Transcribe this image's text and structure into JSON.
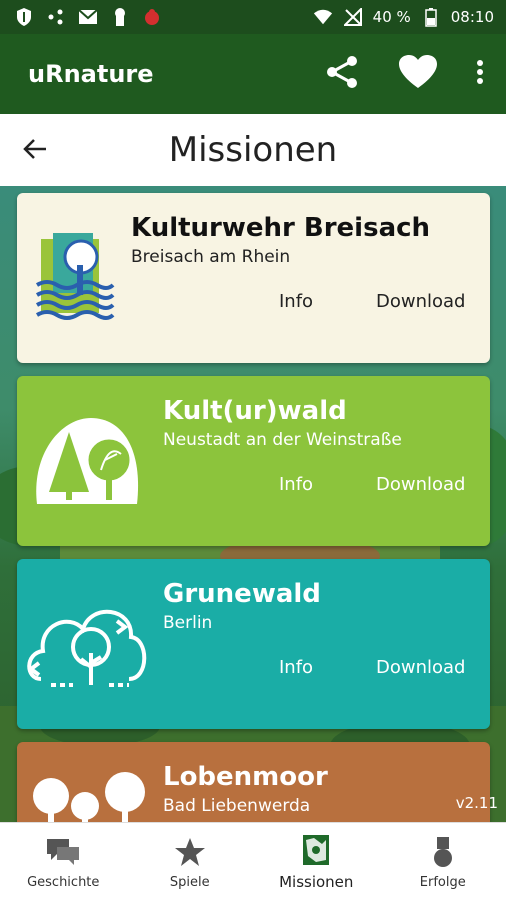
{
  "status_bar": {
    "battery": "40 %",
    "time": "08:10"
  },
  "app_bar": {
    "title": "uRnature"
  },
  "page": {
    "title": "Missionen"
  },
  "missions": [
    {
      "title": "Kulturwehr Breisach",
      "location": "Breisach am Rhein",
      "info_label": "Info",
      "download_label": "Download",
      "color": "#f8f4e3"
    },
    {
      "title": "Kult(ur)wald",
      "location": "Neustadt an der Weinstraße",
      "info_label": "Info",
      "download_label": "Download",
      "color": "#8cc43c"
    },
    {
      "title": "Grunewald",
      "location": "Berlin",
      "info_label": "Info",
      "download_label": "Download",
      "color": "#1aada6"
    },
    {
      "title": "Lobenmoor",
      "location": "Bad Liebenwerda",
      "color": "#b8703e"
    }
  ],
  "version": "v2.11",
  "bottom_nav": [
    {
      "label": "Geschichte",
      "icon": "chat-icon"
    },
    {
      "label": "Spiele",
      "icon": "star-icon"
    },
    {
      "label": "Missionen",
      "icon": "map-icon",
      "active": true
    },
    {
      "label": "Erfolge",
      "icon": "medal-icon"
    }
  ]
}
